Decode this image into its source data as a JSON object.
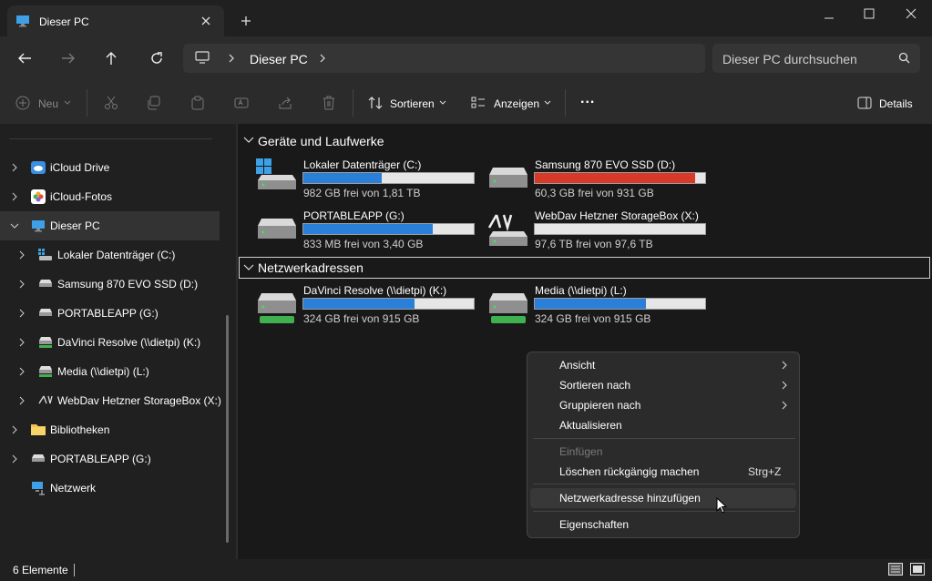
{
  "window": {
    "tab_title": "Dieser PC"
  },
  "address": {
    "root": "Dieser PC",
    "search_placeholder": "Dieser PC durchsuchen"
  },
  "toolbar": {
    "new_label": "Neu",
    "sort_label": "Sortieren",
    "view_label": "Anzeigen",
    "more_label": "...",
    "details_label": "Details"
  },
  "sidebar": {
    "items": [
      {
        "label": "iCloud Drive"
      },
      {
        "label": "iCloud-Fotos"
      },
      {
        "label": "Dieser PC"
      },
      {
        "label": "Lokaler Datenträger (C:)"
      },
      {
        "label": "Samsung 870 EVO SSD (D:)"
      },
      {
        "label": "PORTABLEAPP (G:)"
      },
      {
        "label": "DaVinci Resolve (\\\\dietpi) (K:)"
      },
      {
        "label": "Media (\\\\dietpi) (L:)"
      },
      {
        "label": "WebDav Hetzner StorageBox (X:)"
      },
      {
        "label": "Bibliotheken"
      },
      {
        "label": "PORTABLEAPP (G:)"
      },
      {
        "label": "Netzwerk"
      }
    ]
  },
  "groups": {
    "devices": "Geräte und Laufwerke",
    "network": "Netzwerkadressen"
  },
  "drives": [
    {
      "name": "Lokaler Datenträger (C:)",
      "info": "982 GB frei von 1,81 TB",
      "used_fraction": 0.46,
      "color": "#2a7fd8"
    },
    {
      "name": "Samsung 870 EVO SSD (D:)",
      "info": "60,3 GB frei von 931 GB",
      "used_fraction": 0.94,
      "color": "#d83a2a"
    },
    {
      "name": "PORTABLEAPP (G:)",
      "info": "833 MB frei von 3,40 GB",
      "used_fraction": 0.76,
      "color": "#2a7fd8"
    },
    {
      "name": "WebDav Hetzner StorageBox (X:)",
      "info": "97,6 TB frei von 97,6 TB",
      "used_fraction": 0.0,
      "color": "#2a7fd8"
    }
  ],
  "network_drives": [
    {
      "name": "DaVinci Resolve (\\\\dietpi) (K:)",
      "info": "324 GB frei von 915 GB",
      "used_fraction": 0.65,
      "color": "#2a7fd8"
    },
    {
      "name": "Media (\\\\dietpi) (L:)",
      "info": "324 GB frei von 915 GB",
      "used_fraction": 0.65,
      "color": "#2a7fd8"
    }
  ],
  "context_menu": {
    "items": [
      {
        "label": "Ansicht"
      },
      {
        "label": "Sortieren nach"
      },
      {
        "label": "Gruppieren nach"
      },
      {
        "label": "Aktualisieren"
      },
      {
        "label": "Einfügen"
      },
      {
        "label": "Löschen rückgängig machen",
        "shortcut": "Strg+Z"
      },
      {
        "label": "Netzwerkadresse hinzufügen"
      },
      {
        "label": "Eigenschaften"
      }
    ]
  },
  "status": {
    "count": "6 Elemente"
  }
}
